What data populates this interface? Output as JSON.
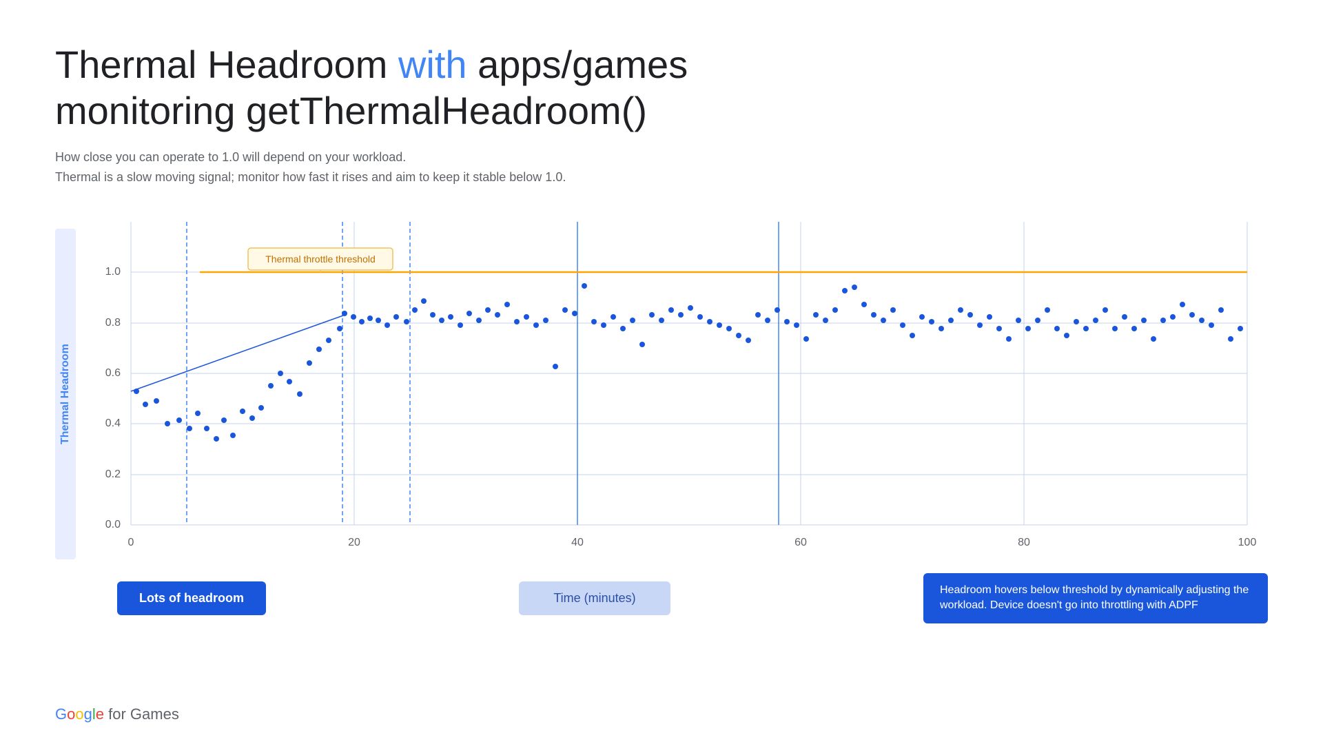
{
  "page": {
    "title_part1": "Thermal Headroom ",
    "title_with": "with",
    "title_part2": " apps/games",
    "title_line2": "monitoring getThermalHeadroom()",
    "subtitle_line1": "How close you can operate to 1.0 will depend on your workload.",
    "subtitle_line2": "Thermal is a slow moving signal; monitor how fast it rises and aim to keep it stable below 1.0.",
    "y_axis_label": "Thermal Headroom",
    "x_axis_label": "Time (minutes)",
    "thermal_throttle_label": "Thermal throttle threshold",
    "lots_of_headroom": "Lots of headroom",
    "time_minutes": "Time (minutes)",
    "headroom_desc": "Headroom hovers below threshold by dynamically adjusting the workload. Device doesn't go into throttling with ADPF",
    "google_branding": "Google for Games"
  },
  "chart": {
    "y_ticks": [
      "0.0",
      "0.2",
      "0.4",
      "0.6",
      "0.8",
      "1.0"
    ],
    "x_ticks": [
      "0",
      "20",
      "40",
      "60",
      "80",
      "100"
    ],
    "threshold_y": 1.0,
    "accent_color": "#FFA500",
    "dot_color": "#1a56db",
    "grid_color": "#c5d0e8",
    "dashed_line_color": "#4285F4"
  }
}
